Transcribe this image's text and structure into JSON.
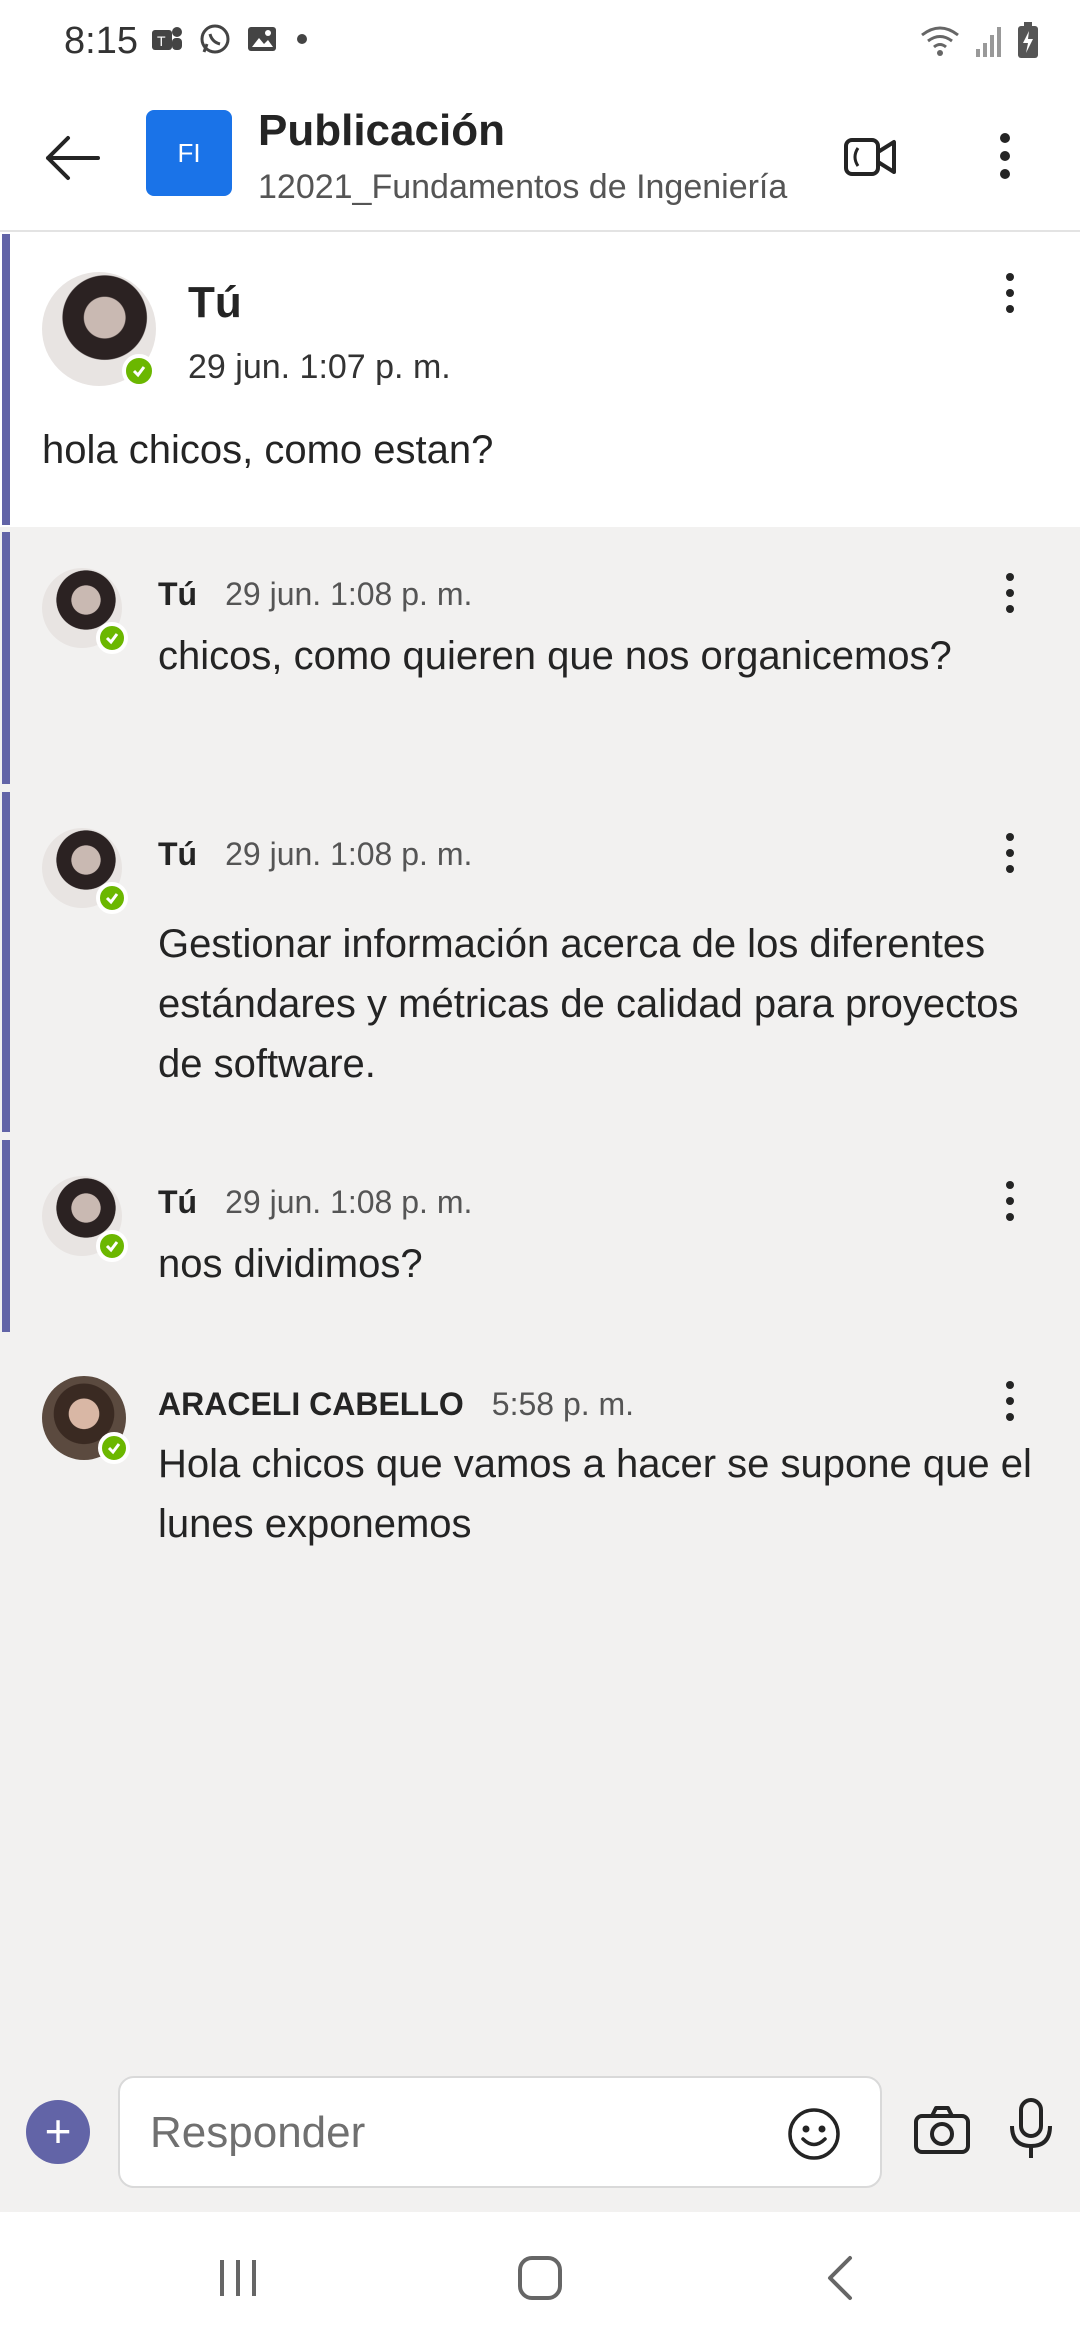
{
  "status_bar": {
    "time": "8:15",
    "left_icons": [
      "teams-icon",
      "whatsapp-icon",
      "gallery-icon",
      "dot-icon"
    ],
    "right_icons": [
      "wifi-icon",
      "signal-icon",
      "battery-icon"
    ]
  },
  "header": {
    "team_initials": "FI",
    "title": "Publicación",
    "subtitle": "12021_Fundamentos de Ingeniería",
    "team_color": "#1a73e8"
  },
  "root_post": {
    "author": "Tú",
    "time": "29 jun. 1:07 p. m.",
    "body": "hola chicos, como estan?"
  },
  "replies": [
    {
      "author": "Tú",
      "time": "29 jun. 1:08 p. m.",
      "body": "chicos, como quieren que nos organicemos?"
    },
    {
      "author": "Tú",
      "time": "29 jun. 1:08 p. m.",
      "body": "Gestionar información acerca de los diferentes estándares y métricas de calidad para proyectos de software."
    },
    {
      "author": "Tú",
      "time": "29 jun. 1:08 p. m.",
      "body": "nos dividimos?"
    },
    {
      "author": "ARACELI CABELLO",
      "time": "5:58 p. m.",
      "body": "Hola chicos que vamos a hacer se supone que el lunes exponemos"
    }
  ],
  "compose": {
    "placeholder": "Responder"
  },
  "colors": {
    "accent": "#6264a7",
    "presence": "#6bb700",
    "background": "#f2f1f0"
  }
}
